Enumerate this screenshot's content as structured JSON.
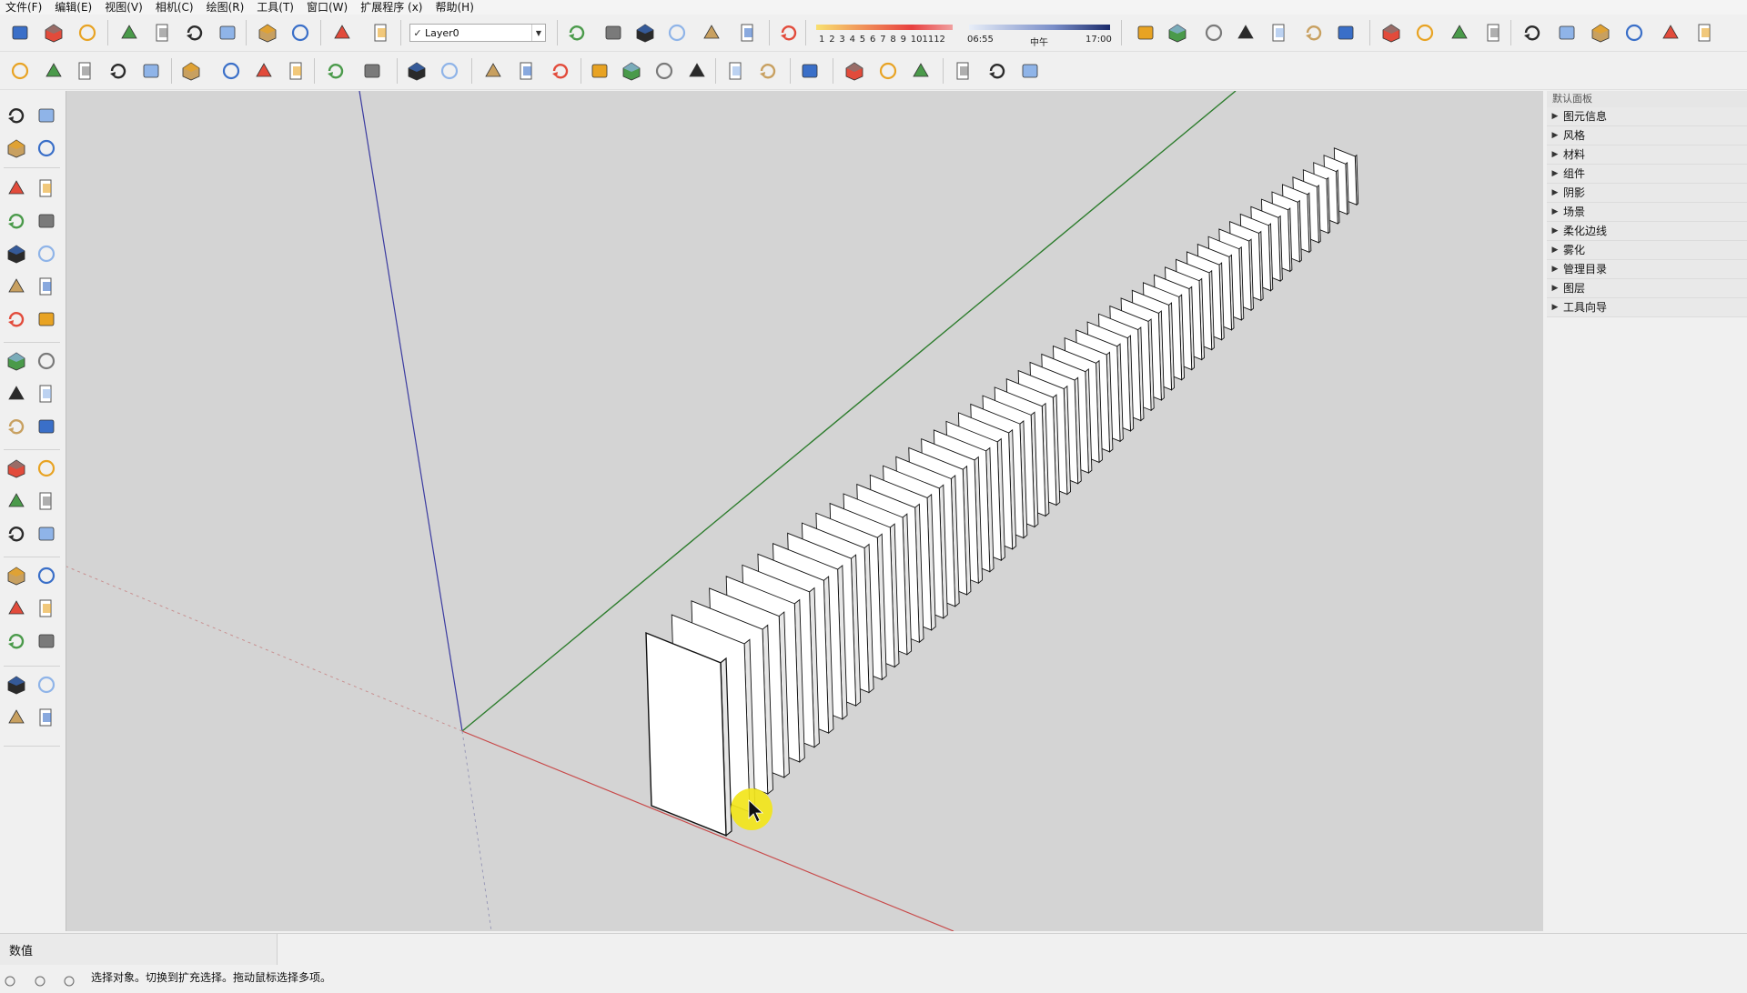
{
  "menu": [
    "文件(F)",
    "编辑(E)",
    "视图(V)",
    "相机(C)",
    "绘图(R)",
    "工具(T)",
    "窗口(W)",
    "扩展程序 (x)",
    "帮助(H)"
  ],
  "layer": {
    "current": "Layer0",
    "checked": "✓"
  },
  "shadow": {
    "months": [
      "1",
      "2",
      "3",
      "4",
      "5",
      "6",
      "7",
      "8",
      "9",
      "10",
      "11",
      "12"
    ],
    "time_start": "06:55",
    "time_mid": "中午",
    "time_end": "17:00"
  },
  "tray": {
    "title": "默认面板",
    "items": [
      {
        "label": "图元信息"
      },
      {
        "label": "风格"
      },
      {
        "label": "材料"
      },
      {
        "label": "组件"
      },
      {
        "label": "阴影"
      },
      {
        "label": "场景"
      },
      {
        "label": "柔化边线"
      },
      {
        "label": "雾化"
      },
      {
        "label": "管理目录"
      },
      {
        "label": "图层"
      },
      {
        "label": "工具向导"
      }
    ]
  },
  "measurements": {
    "label": "数值"
  },
  "status": {
    "text": "选择对象。切换到扩充选择。拖动鼠标选择多项。"
  },
  "colors": {
    "viewport": "#d4d4d4",
    "axis_red": "#c84a4a",
    "axis_green": "#2e7d2e",
    "axis_blue": "#3a3aa0",
    "cursor_highlight": "#f2e51a"
  },
  "icons": {
    "toolbar1": [
      "new-file-icon",
      "open-folder-icon",
      "save-icon",
      "cut-icon",
      "copy-icon",
      "paste-icon",
      "erase-icon",
      "undo-icon",
      "redo-icon",
      "print-icon",
      "model-info-icon",
      "layer-manager-icon",
      "section-plane-icon",
      "section-cut-icon",
      "section-fill-icon",
      "display-section-icon",
      "display-cuts-icon",
      "shadow-toggle-icon",
      "xray-icon",
      "back-edges-icon",
      "wireframe-icon",
      "hidden-line-icon",
      "shaded-icon",
      "shaded-texture-icon",
      "monochrome-icon",
      "axes-icon",
      "iso-view-icon",
      "top-view-icon",
      "front-view-icon",
      "right-view-icon",
      "back-view-icon",
      "left-view-icon",
      "house-icon",
      "warehouse-icon",
      "extension-warehouse-icon"
    ],
    "toolbar2": [
      "component-icon",
      "reload-icon",
      "sandbox-icon",
      "add-location-icon",
      "photo-texture-icon",
      "google-earth-icon",
      "shield-icon",
      "tree-icon",
      "camera-frame-icon",
      "sound-icon",
      "settings-sliders-icon",
      "comment-icon",
      "info-icon",
      "doc-icon",
      "doc2-icon",
      "doc3-icon",
      "grid1-icon",
      "grid2-icon",
      "grid3-icon",
      "grid4-icon",
      "grid5-icon",
      "grid6-icon",
      "globe-icon",
      "solid-outer-shell-icon",
      "solid-intersect-icon",
      "solid-union-icon",
      "arrow-tool-icon",
      "ruby-console-icon",
      "ruby-run-icon"
    ],
    "left_palette": [
      "select-icon",
      "make-component-icon",
      "paint-bucket-icon",
      "eraser-icon",
      "pencil-icon",
      "freehand-icon",
      "rectangle-icon",
      "rotated-rectangle-icon",
      "circle-icon",
      "polygon-icon",
      "arc-icon",
      "two-point-arc-icon",
      "three-point-arc-icon",
      "pie-icon",
      "move-icon",
      "push-pull-icon",
      "rotate-icon",
      "follow-me-icon",
      "scale-icon",
      "offset-icon",
      "tape-measure-icon",
      "dimension-icon",
      "protractor-icon",
      "text-icon",
      "axes-tool-icon",
      "3d-text-icon",
      "orbit-icon",
      "pan-icon",
      "zoom-icon",
      "zoom-window-icon",
      "zoom-extents-icon",
      "previous-view-icon",
      "position-camera-icon",
      "look-around-icon",
      "walk-icon",
      "section-plane-tool-icon"
    ]
  }
}
